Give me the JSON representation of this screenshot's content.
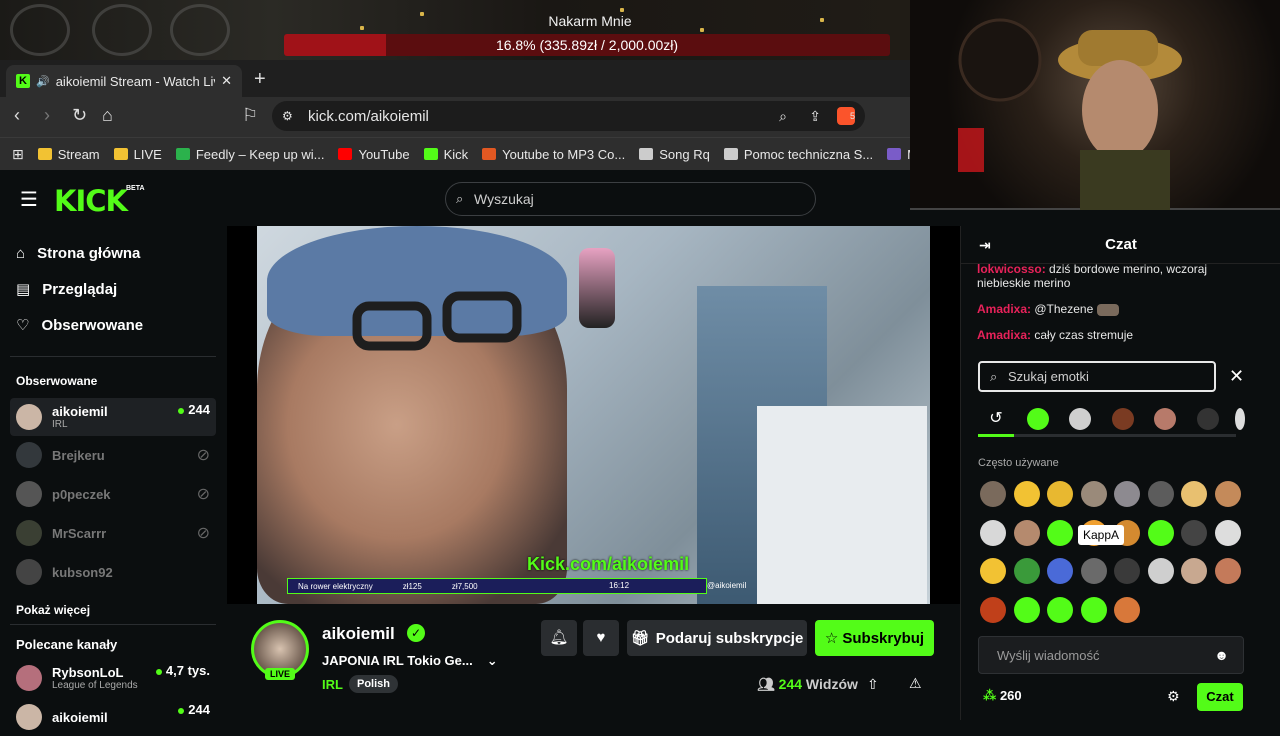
{
  "overlay": {
    "goal_title": "Nakarm Mnie",
    "goal_text": "16.8% (335.89zł / 2,000.00zł)",
    "goal_fraction": 0.168
  },
  "browser": {
    "tab_title": "aikoiemil Stream - Watch Live",
    "url": "kick.com/aikoiemil",
    "shield_count": "5",
    "bookmarks": [
      {
        "label": "Stream",
        "color": "#f2c233"
      },
      {
        "label": "LIVE",
        "color": "#f2c233"
      },
      {
        "label": "Feedly – Keep up wi...",
        "color": "#2bb24c"
      },
      {
        "label": "YouTube",
        "color": "#ff0000"
      },
      {
        "label": "Kick",
        "color": "#53fc18"
      },
      {
        "label": "Youtube to MP3 Co...",
        "color": "#e25822"
      },
      {
        "label": "Song Rq",
        "color": "#cccccc"
      },
      {
        "label": "Pomoc techniczna S...",
        "color": "#cccccc"
      },
      {
        "label": "Mo",
        "color": "#7a5cc8"
      }
    ]
  },
  "kick": {
    "logo": "KICK",
    "beta": "BETA",
    "search_placeholder": "Wyszukaj"
  },
  "sidebar": {
    "nav": [
      {
        "label": "Strona główna",
        "icon": "home-icon"
      },
      {
        "label": "Przeglądaj",
        "icon": "browse-icon"
      },
      {
        "label": "Obserwowane",
        "icon": "heart-icon"
      }
    ],
    "followed_title": "Obserwowane",
    "followed": [
      {
        "name": "aikoiemil",
        "sub": "IRL",
        "count": "244",
        "live": true
      },
      {
        "name": "Brejkeru",
        "live": false
      },
      {
        "name": "p0peczek",
        "live": false
      },
      {
        "name": "MrScarrr",
        "live": false
      },
      {
        "name": "kubson92",
        "live": false
      }
    ],
    "show_more": "Pokaż więcej",
    "recommended_title": "Polecane kanały",
    "recommended": [
      {
        "name": "RybsonLoL",
        "sub": "League of Legends",
        "count": "4,7 tys."
      },
      {
        "name": "aikoiemil",
        "sub": "",
        "count": "244"
      }
    ]
  },
  "video": {
    "watermark": "Kick.com/aikoiemil",
    "bar_text": "Na rower elektryczny",
    "bar_amount1": "zł125",
    "bar_amount2": "zł7,500",
    "bar_time": "16:12",
    "bar_handle": "@aikoiemil"
  },
  "stream": {
    "channel": "aikoiemil",
    "live": "LIVE",
    "title": "JAPONIA IRL Tokio Ge...",
    "category": "IRL",
    "tag": "Polish",
    "gift_label": "Podaruj subskrypcje",
    "subscribe_label": "Subskrybuj",
    "viewers_count": "244",
    "viewers_label": "Widzów"
  },
  "chat": {
    "title": "Czat",
    "messages": [
      {
        "user": "lokwicosso:",
        "text": " dziś bordowe merino, wczoraj niebieskie merino"
      },
      {
        "user": "Amadixa:",
        "text": " @Thezene"
      },
      {
        "user": "Amadixa:",
        "text": " cały czas stremuje"
      }
    ],
    "emote_search_placeholder": "Szukaj emotki",
    "frequent_label": "Często używane",
    "tooltip": "KappA",
    "input_placeholder": "Wyślij wiadomość",
    "points": "260",
    "send_label": "Czat"
  }
}
